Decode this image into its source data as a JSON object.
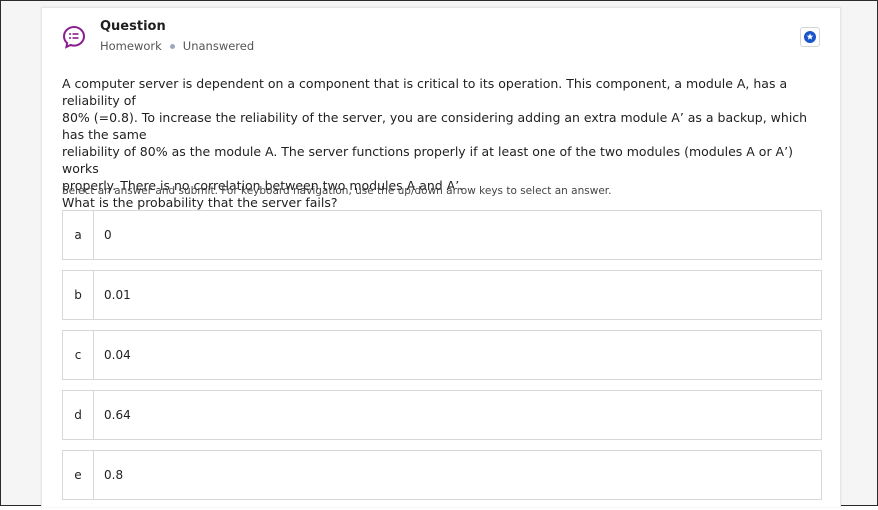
{
  "header": {
    "title": "Question",
    "type_label": "Homework",
    "status_label": "Unanswered",
    "icon": "question-chat-icon",
    "accent": "#8a1e8f"
  },
  "bookmark": {
    "icon": "star-badge-icon",
    "color": "#1a56c9"
  },
  "question": {
    "text_lines": [
      "A computer server is dependent on a component that is critical to its operation. This component, a module A, has a reliability of",
      "80% (=0.8). To increase the reliability of the server, you are considering adding an extra module A’ as a backup, which has the same",
      "reliability of 80% as the module A. The server functions properly if at least one of the two modules (modules A or A’) works",
      "properly. There is no correlation between two modules A and A’.",
      "What is the probability that the server fails?"
    ]
  },
  "instruction": "Select an answer and submit. For keyboard navigation, use the up/down arrow keys to select an answer.",
  "options": [
    {
      "letter": "a",
      "value": "0"
    },
    {
      "letter": "b",
      "value": "0.01"
    },
    {
      "letter": "c",
      "value": "0.04"
    },
    {
      "letter": "d",
      "value": "0.64"
    },
    {
      "letter": "e",
      "value": "0.8"
    }
  ]
}
